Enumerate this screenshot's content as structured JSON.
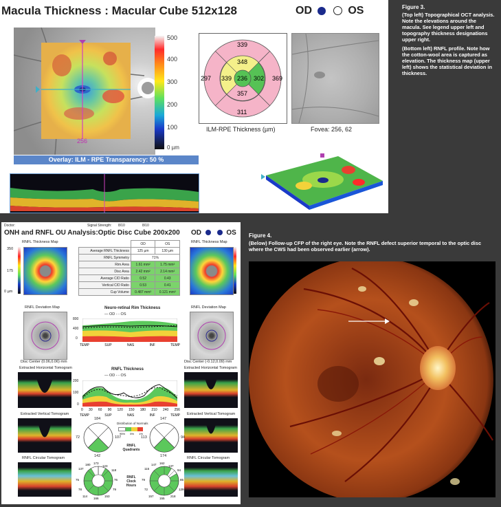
{
  "top": {
    "title": "Macula Thickness : Macular Cube 512x128",
    "eye_od": "OD",
    "eye_os": "OS",
    "scale_ticks": [
      "500",
      "400",
      "300",
      "200",
      "100",
      "0 µm"
    ],
    "marker_label": "256",
    "overlay_label": "Overlay: ILM - RPE  Transparency: 50 %",
    "etdrs": {
      "outer_superior": "339",
      "outer_nasal_left": "297",
      "outer_temporal_right": "369",
      "outer_inferior": "311",
      "inner_superior": "348",
      "inner_left": "339",
      "center": "236",
      "inner_right": "302",
      "inner_inferior": "357",
      "caption": "ILM-RPE Thickness (µm)"
    },
    "fovea_caption": "Fovea: 256, 62"
  },
  "figure3": {
    "heading": "Figure 3.",
    "text1": "(Top left) Topographical OCT analysis. Note the elevations around the macula. See legend upper left and topography thickness designations upper right.",
    "text2": "(Bottom left) RNFL profile. Note how the cotton-wool area is captured as elevation. The thickness map (upper left) shows the statistical deviation in thickness."
  },
  "bottom_left": {
    "meta_doctor": "Doctor:",
    "meta_signal": "Signal Strength:",
    "meta_signal_od": "8/10",
    "meta_signal_os": "8/10",
    "title": "ONH and RNFL OU Analysis:Optic Disc Cube 200x200",
    "eye_od": "OD",
    "eye_os": "OS",
    "thickness_map_label": "RNFL Thickness Map",
    "map_ticks": [
      "350",
      "175",
      "0 µm"
    ],
    "table": {
      "col_od": "OD",
      "col_os": "OS",
      "rows": [
        {
          "label": "Average RNFL Thickness",
          "od": "125 µm",
          "os": "130 µm",
          "green": false
        },
        {
          "label": "RNFL Symmetry",
          "od": "71%",
          "os": "",
          "green": false,
          "merged": true
        },
        {
          "label": "Rim Area",
          "od": "1.61 mm²",
          "os": "1.75 mm²",
          "green": true
        },
        {
          "label": "Disc Area",
          "od": "2.42 mm²",
          "os": "2.14 mm²",
          "green": true
        },
        {
          "label": "Average C/D Ratio",
          "od": "0.52",
          "os": "0.43",
          "green": true
        },
        {
          "label": "Vertical C/D Ratio",
          "od": "0.53",
          "os": "0.41",
          "green": true
        },
        {
          "label": "Cup Volume",
          "od": "0.487 mm³",
          "os": "0.121 mm³",
          "green": true
        }
      ]
    },
    "deviation_map_label": "RNFL Deviation Map",
    "rim_chart_title": "Neuro-retinal Rim Thickness",
    "legend_od": "OD",
    "legend_os": "OS",
    "x_labels": [
      "TEMP",
      "SUP",
      "NAS",
      "INF",
      "TEMP"
    ],
    "rnfl_chart_title": "RNFL Thickness",
    "rim_yticks": [
      "800",
      "400",
      "0"
    ],
    "rnfl_yticks": [
      "200",
      "100",
      "0"
    ],
    "rnfl_xticks": [
      "0",
      "30",
      "60",
      "90",
      "120",
      "150",
      "180",
      "210",
      "240",
      "256"
    ],
    "disc_center_od": "Disc Center (0.06,0.06) mm",
    "disc_center_os": "Disc Center (-0.12,0.09) mm",
    "ext_horizontal": "Extracted Horizontal Tomogram",
    "ext_vertical": "Extracted Vertical Tomogram",
    "circular_tomogram": "RNFL Circular Tomogram",
    "quadrants_label": "RNFL Quadrants",
    "clock_label": "RNFL Clock Hours",
    "distribution_label": "Distribution of Normals",
    "distribution_pcts": [
      "95%",
      "5%",
      "1%"
    ],
    "quadrants_od": {
      "top": "184",
      "left": "72",
      "right": "107",
      "bottom": "142"
    },
    "quadrants_os": {
      "top": "147",
      "left": "113",
      "right": "94",
      "bottom": "174"
    },
    "clock_od": [
      "173",
      "123",
      "137",
      "118",
      "75",
      "76",
      "78",
      "79",
      "114",
      "153",
      "166",
      "180"
    ],
    "clock_os": [
      "162",
      "137",
      "115",
      "94",
      "79",
      "85",
      "72",
      "129",
      "157",
      "218",
      "155",
      "147"
    ]
  },
  "figure4": {
    "heading": "Figure 4.",
    "text": "(Below) Follow-up CFP of the right eye.  Note the RNFL defect superior temporal to the optic disc where the CWS had been observed earlier (arrow)."
  },
  "colors": {
    "background": "#3a3a3a",
    "scale_bar_label_bg": "#5b86c9",
    "green_cell": "#7bd36b",
    "pink_zone": "#f5b4c8",
    "yellow_zone": "#f4f08a",
    "green_zone": "#56c255"
  }
}
